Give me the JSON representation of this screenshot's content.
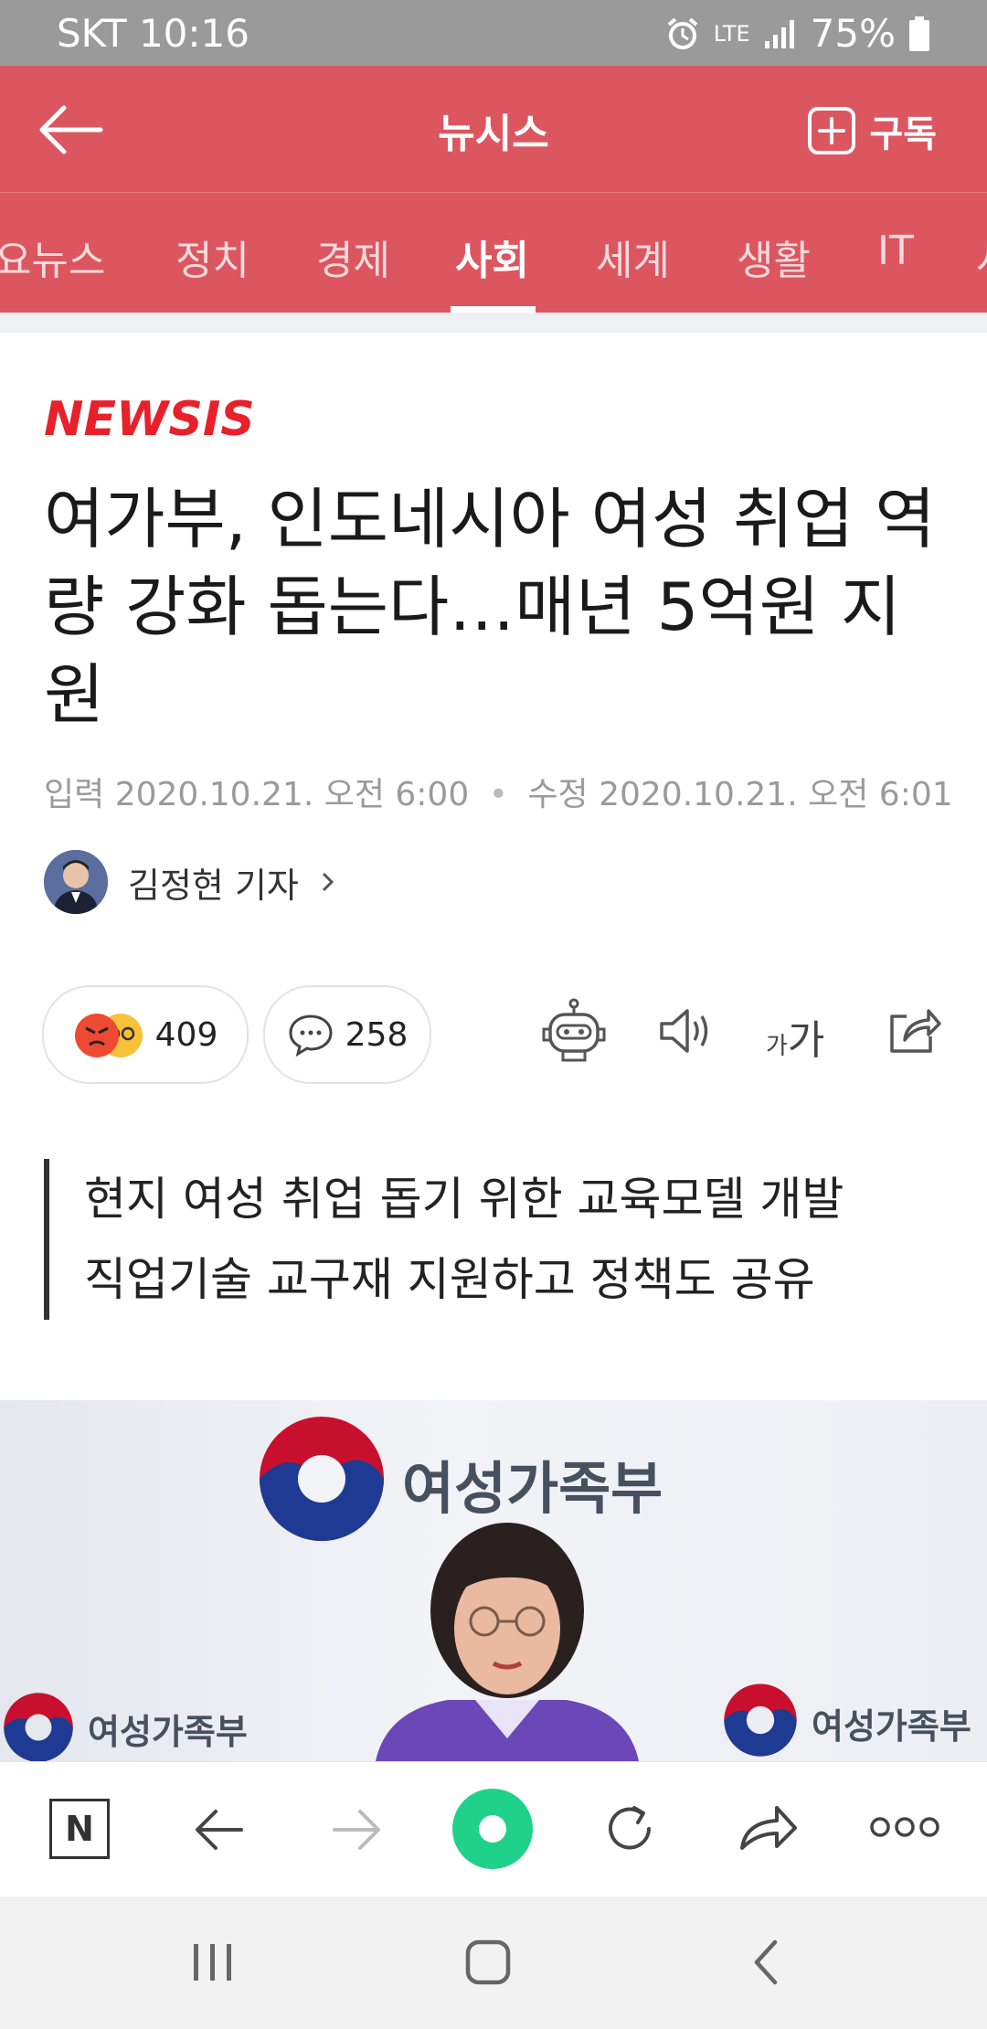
{
  "status": {
    "carrier_time": "SKT 10:16",
    "network": "LTE",
    "battery": "75%"
  },
  "appbar": {
    "title": "뉴시스",
    "subscribe_label": "구독"
  },
  "tabs": [
    {
      "label": "요뉴스",
      "active": false
    },
    {
      "label": "정치",
      "active": false
    },
    {
      "label": "경제",
      "active": false
    },
    {
      "label": "사회",
      "active": true
    },
    {
      "label": "세계",
      "active": false
    },
    {
      "label": "생활",
      "active": false
    },
    {
      "label": "IT",
      "active": false
    },
    {
      "label": "사",
      "active": false
    }
  ],
  "article": {
    "publisher_logo": "NEWSIS",
    "headline": "여가부, 인도네시아 여성 취업 역량 강화 돕는다…매년 5억원 지원",
    "input_label": "입력",
    "input_time": "2020.10.21. 오전 6:00",
    "modified_label": "수정",
    "modified_time": "2020.10.21. 오전 6:01",
    "author": "김정현 기자",
    "reaction_count": "409",
    "comment_count": "258",
    "font_size_label_small": "가",
    "font_size_label_large": "가",
    "subheadline": [
      "현지 여성 취업 돕기 위한 교육모델 개발",
      "직업기술 교구재 지원하고 정책도 공유"
    ],
    "photo_texts": {
      "banner": "여성가족부",
      "left": "여성가족부",
      "right": "여성가족부"
    }
  },
  "browser": {
    "home_label": "N"
  },
  "colors": {
    "accent": "#dc5660",
    "logo": "#e8202a",
    "quote_bar": "#333333",
    "browser_center": "#1fd18a"
  }
}
